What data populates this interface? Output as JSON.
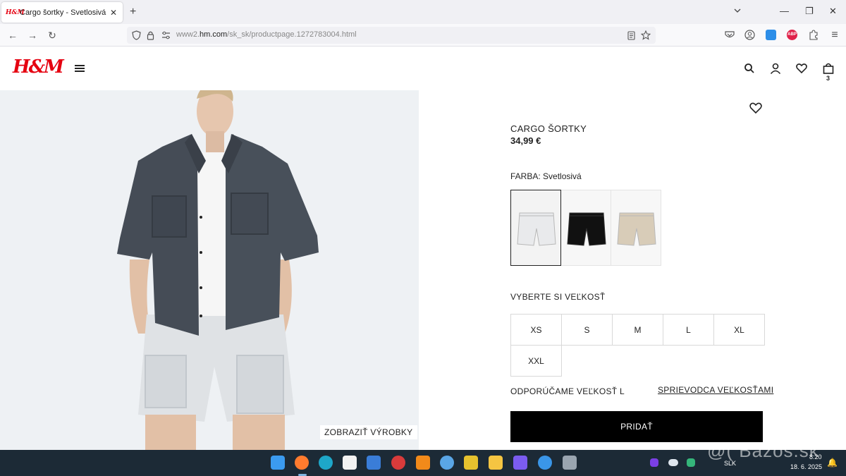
{
  "browser": {
    "tab_title": "Cargo šortky - Svetlosivá - MUŽ",
    "tab_favicon": "H&M",
    "url_prefix": "www2.",
    "url_domain": "hm.com",
    "url_path": "/sk_sk/productpage.1272783004.html"
  },
  "header": {
    "logo": "H&M",
    "cart_count": "3"
  },
  "gallery": {
    "show_products_label": "ZOBRAZIŤ VÝROBKY"
  },
  "product": {
    "title": "CARGO ŠORTKY",
    "price": "34,99 €",
    "color_label": "FARBA: Svetlosivá",
    "colors": [
      "#e9eaec",
      "#111111",
      "#d8ccb8"
    ],
    "size_label": "VYBERTE SI VEĽKOSŤ",
    "sizes": [
      "XS",
      "S",
      "M",
      "L",
      "XL",
      "XXL"
    ],
    "recommend_label": "ODPORÚČAME VEĽKOSŤ L",
    "size_guide_label": "SPRIEVODCA VEĽKOSŤAMI",
    "add_label": "PRIDAŤ"
  },
  "taskbar": {
    "language": "SLK",
    "time": "8:20",
    "date": "18. 6. 2025"
  },
  "watermark": "@( Bazos.sk",
  "colors": {
    "brand_red": "#e50010",
    "button_black": "#000000",
    "taskbar": "#1c2a36"
  }
}
